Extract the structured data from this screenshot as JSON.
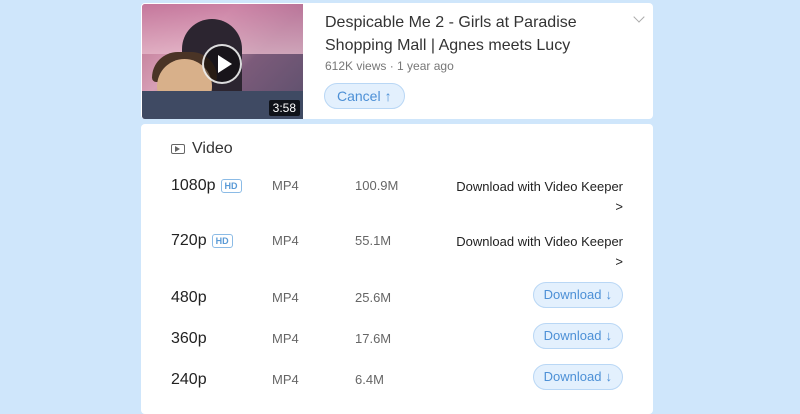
{
  "video": {
    "title": "Despicable Me 2 - Girls at Paradise Shopping Mall | Agnes meets Lucy",
    "meta": "612K views · 1 year ago",
    "duration": "3:58",
    "cancel_label": "Cancel",
    "cancel_icon": "↑"
  },
  "section": {
    "label": "Video"
  },
  "formats": [
    {
      "resolution": "1080p",
      "hd": "HD",
      "format": "MP4",
      "size": "100.9M",
      "action": "Download with Video Keeper",
      "action_arrow": ">"
    },
    {
      "resolution": "720p",
      "hd": "HD",
      "format": "MP4",
      "size": "55.1M",
      "action": "Download with Video Keeper",
      "action_arrow": ">"
    },
    {
      "resolution": "480p",
      "format": "MP4",
      "size": "25.6M",
      "action": "Download",
      "action_icon": "↓"
    },
    {
      "resolution": "360p",
      "format": "MP4",
      "size": "17.6M",
      "action": "Download",
      "action_icon": "↓"
    },
    {
      "resolution": "240p",
      "format": "MP4",
      "size": "6.4M",
      "action": "Download",
      "action_icon": "↓"
    }
  ],
  "colors": {
    "background": "#cfe6fb",
    "accent": "#4d90d6",
    "button_bg": "#e3f0fd"
  }
}
